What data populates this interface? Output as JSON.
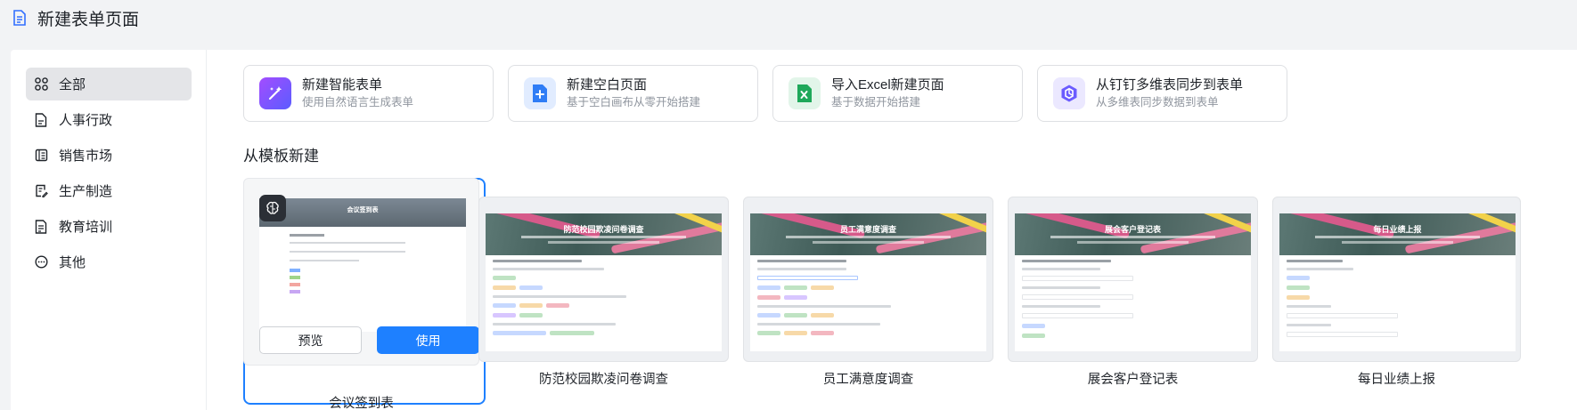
{
  "header": {
    "title": "新建表单页面",
    "icon": "document-icon"
  },
  "sidebar": {
    "items": [
      {
        "label": "全部",
        "icon": "grid-icon",
        "active": true
      },
      {
        "label": "人事行政",
        "icon": "document-icon"
      },
      {
        "label": "销售市场",
        "icon": "ledger-icon"
      },
      {
        "label": "生产制造",
        "icon": "clipboard-edit-icon"
      },
      {
        "label": "教育培训",
        "icon": "checklist-icon"
      },
      {
        "label": "其他",
        "icon": "more-circle-icon"
      }
    ]
  },
  "quick_actions": [
    {
      "title": "新建智能表单",
      "subtitle": "使用自然语言生成表单",
      "icon": "magic-wand-icon",
      "color": "#7b4dff"
    },
    {
      "title": "新建空白页面",
      "subtitle": "基于空白画布从零开始搭建",
      "icon": "add-page-icon",
      "color": "#2f7df6"
    },
    {
      "title": "导入Excel新建页面",
      "subtitle": "基于数据开始搭建",
      "icon": "excel-icon",
      "color": "#1fa85a"
    },
    {
      "title": "从钉钉多维表同步到表单",
      "subtitle": "从多维表同步数据到表单",
      "icon": "multidim-table-icon",
      "color": "#6b5cff"
    }
  ],
  "templates_section": {
    "title": "从模板新建",
    "templates": [
      {
        "name": "会议签到表",
        "banner_title": "会议签到表"
      },
      {
        "name": "防范校园欺凌问卷调查",
        "banner_title": "防范校园欺凌问卷调查"
      },
      {
        "name": "员工满意度调查",
        "banner_title": "员工满意度调查"
      },
      {
        "name": "展会客户登记表",
        "banner_title": "展会客户登记表"
      },
      {
        "name": "每日业绩上报",
        "banner_title": "每日业绩上报"
      }
    ],
    "selected_actions": {
      "preview": "预览",
      "use": "使用"
    }
  },
  "colors": {
    "accent": "#1e80ff"
  }
}
